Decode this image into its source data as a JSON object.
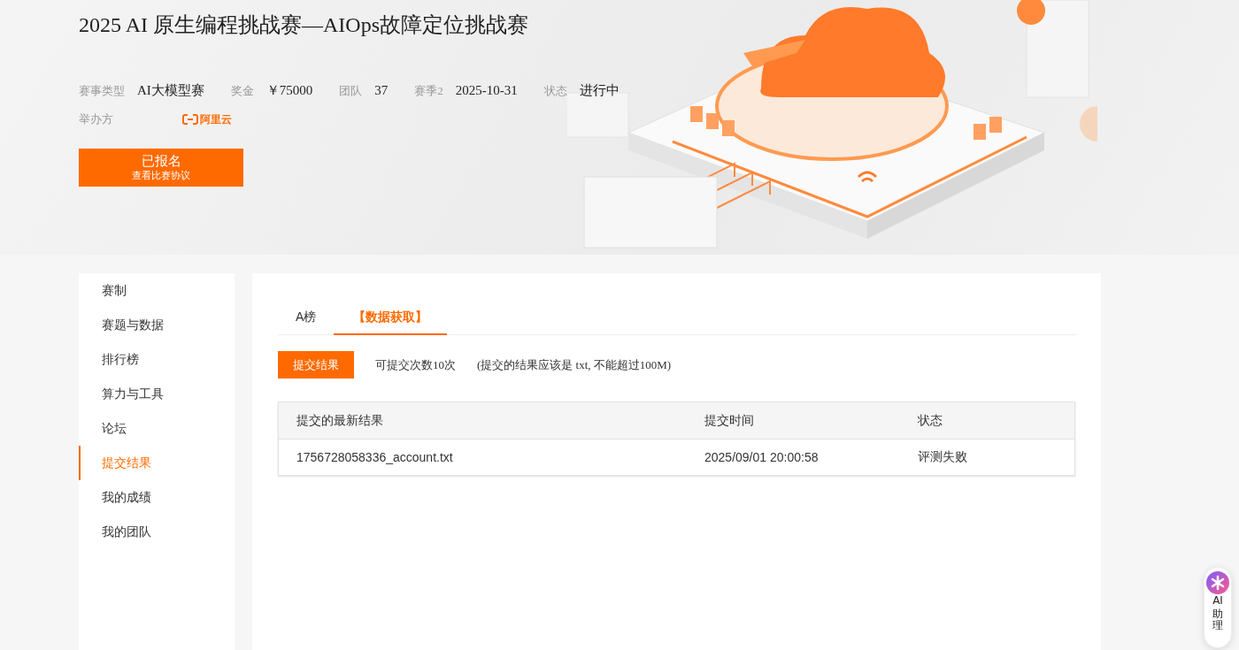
{
  "title": "2025 AI 原生编程挑战赛—AIOps故障定位挑战赛",
  "meta": [
    {
      "label": "赛事类型",
      "value": "AI大模型赛"
    },
    {
      "label": "奖金",
      "value": "￥75000"
    },
    {
      "label": "团队",
      "value": "37"
    },
    {
      "label": "赛季2",
      "value": "2025-10-31"
    },
    {
      "label": "状态",
      "value": "进行中"
    }
  ],
  "organizer": {
    "label": "举办方",
    "logo_text": "阿里云"
  },
  "register_button": {
    "label": "已报名",
    "sublabel": "查看比赛协议"
  },
  "sidebar": {
    "items": [
      {
        "label": "赛制",
        "selected": false
      },
      {
        "label": "赛题与数据",
        "selected": false
      },
      {
        "label": "排行榜",
        "selected": false
      },
      {
        "label": "算力与工具",
        "selected": false
      },
      {
        "label": "论坛",
        "selected": false
      },
      {
        "label": "提交结果",
        "selected": true
      },
      {
        "label": "我的成绩",
        "selected": false
      },
      {
        "label": "我的团队",
        "selected": false
      }
    ]
  },
  "tabs": [
    {
      "label": "A榜",
      "selected": false
    },
    {
      "label": "【数据获取】",
      "selected": true
    }
  ],
  "submit": {
    "button": "提交结果",
    "count_note": "可提交次数10次",
    "hint": "(提交的结果应该是 txt, 不能超过100M)"
  },
  "table": {
    "columns": [
      "提交的最新结果",
      "提交时间",
      "状态"
    ],
    "rows": [
      [
        "1756728058336_account.txt",
        "2025/09/01 20:00:58",
        "评测失败"
      ]
    ]
  },
  "assistant": {
    "label": "AI",
    "label2": "助理"
  }
}
